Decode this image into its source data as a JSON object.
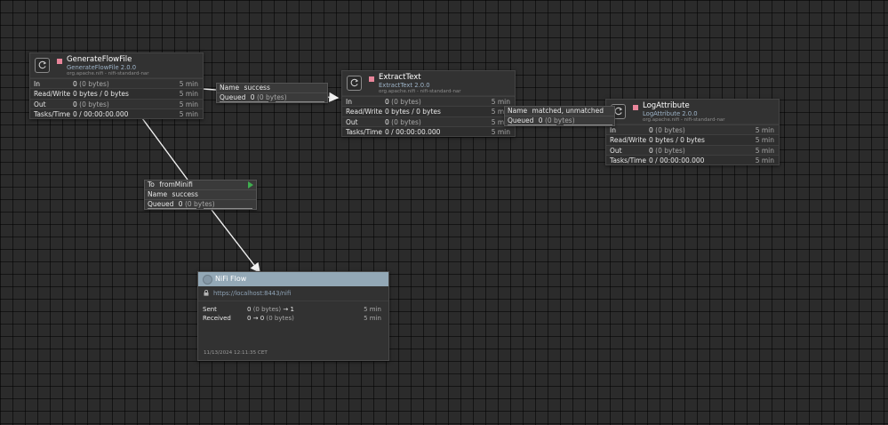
{
  "processors": [
    {
      "name": "GenerateFlowFile",
      "type": "GenerateFlowFile 2.0.0",
      "bundle": "org.apache.nifi - nifi-standard-nar",
      "stats": [
        {
          "label": "In",
          "count": "0",
          "detail": "(0 bytes)",
          "time": "5 min"
        },
        {
          "label": "Read/Write",
          "count": "0 bytes / 0 bytes",
          "detail": "",
          "time": "5 min"
        },
        {
          "label": "Out",
          "count": "0",
          "detail": "(0 bytes)",
          "time": "5 min"
        },
        {
          "label": "Tasks/Time",
          "count": "0 / 00:00:00.000",
          "detail": "",
          "time": "5 min"
        }
      ]
    },
    {
      "name": "ExtractText",
      "type": "ExtractText 2.0.0",
      "bundle": "org.apache.nifi - nifi-standard-nar",
      "stats": [
        {
          "label": "In",
          "count": "0",
          "detail": "(0 bytes)",
          "time": "5 min"
        },
        {
          "label": "Read/Write",
          "count": "0 bytes / 0 bytes",
          "detail": "",
          "time": "5 min"
        },
        {
          "label": "Out",
          "count": "0",
          "detail": "(0 bytes)",
          "time": "5 min"
        },
        {
          "label": "Tasks/Time",
          "count": "0 / 00:00:00.000",
          "detail": "",
          "time": "5 min"
        }
      ]
    },
    {
      "name": "LogAttribute",
      "type": "LogAttribute 2.0.0",
      "bundle": "org.apache.nifi - nifi-standard-nar",
      "stats": [
        {
          "label": "In",
          "count": "0",
          "detail": "(0 bytes)",
          "time": "5 min"
        },
        {
          "label": "Read/Write",
          "count": "0 bytes / 0 bytes",
          "detail": "",
          "time": "5 min"
        },
        {
          "label": "Out",
          "count": "0",
          "detail": "(0 bytes)",
          "time": "5 min"
        },
        {
          "label": "Tasks/Time",
          "count": "0 / 00:00:00.000",
          "detail": "",
          "time": "5 min"
        }
      ]
    }
  ],
  "connections": [
    {
      "name_key": "Name",
      "name": "success",
      "queued_key": "Queued",
      "queued_count": "0",
      "queued_detail": "(0 bytes)"
    },
    {
      "name_key": "Name",
      "name": "matched, unmatched",
      "queued_key": "Queued",
      "queued_count": "0",
      "queued_detail": "(0 bytes)"
    },
    {
      "to_key": "To",
      "to": "fromMinifi",
      "name_key": "Name",
      "name": "success",
      "queued_key": "Queued",
      "queued_count": "0",
      "queued_detail": "(0 bytes)"
    }
  ],
  "remote_group": {
    "title": "NiFi Flow",
    "url": "https://localhost:8443/nifi",
    "sent_label": "Sent",
    "sent_value": "0",
    "sent_detail": "(0 bytes)",
    "sent_arrow": "→ 1",
    "sent_time": "5 min",
    "received_label": "Received",
    "received_value": "0 → 0",
    "received_detail": "(0 bytes)",
    "received_time": "5 min",
    "timestamp": "11/13/2024 12:11:35 CET"
  },
  "colors": {
    "stopped": "#e8859a",
    "running": "#3fae4f",
    "rpg_header": "#93a8b6"
  },
  "icons": [
    "processor-icon",
    "stopped-icon",
    "transmitting-icon",
    "lock-icon",
    "remote-group-icon"
  ]
}
